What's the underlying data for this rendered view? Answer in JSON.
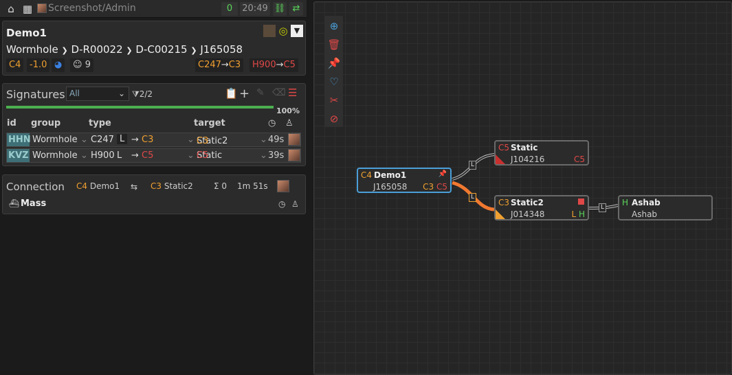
{
  "topbar": {
    "title": "Screenshot/Admin",
    "count": "0",
    "time": "20:49"
  },
  "system": {
    "name": "Demo1",
    "path": [
      "Wormhole",
      "D-R00022",
      "D-C00215",
      "J165058"
    ],
    "class": "C4",
    "security": "-1.0",
    "pilots": "9",
    "statics": [
      {
        "code": "C247",
        "target": "C3"
      },
      {
        "code": "H900",
        "target": "C5"
      }
    ]
  },
  "signatures": {
    "title": "Signatures",
    "filter": "All",
    "count": "2/2",
    "progress_label": "100%",
    "progress_value": 1.0,
    "columns": {
      "id": "id",
      "group": "group",
      "type": "type",
      "target": "target"
    },
    "rows": [
      {
        "id": "HHN",
        "group": "Wormhole",
        "type": "C247",
        "life": "L",
        "dest": "C3",
        "target": "Static2",
        "target_class": "C3",
        "age": "49s"
      },
      {
        "id": "KVZ",
        "group": "Wormhole",
        "type": "H900",
        "life": "L",
        "dest": "C5",
        "target": "Static",
        "target_class": "C5",
        "age": "39s"
      }
    ]
  },
  "connection": {
    "title": "Connection",
    "from_class": "C4",
    "from": "Demo1",
    "to_class": "C3",
    "to": "Static2",
    "mass_sum": "Σ 0",
    "age": "1m 51s",
    "mass_label": "Mass"
  },
  "map": {
    "nodes": [
      {
        "class": "C4",
        "name": "Demo1",
        "jid": "J165058",
        "eff1": "C3",
        "eff2": "C5"
      },
      {
        "class": "C5",
        "name": "Static",
        "jid": "J104216",
        "eff1": "C5"
      },
      {
        "class": "C3",
        "name": "Static2",
        "jid": "J014348",
        "eff1": "L",
        "eff2": "H"
      },
      {
        "class": "H",
        "name": "Ashab",
        "jid": "Ashab"
      }
    ],
    "link_label": "L"
  },
  "colors": {
    "c4": "#f0a030",
    "c5": "#e04848",
    "hs": "#5bd55b",
    "accent": "#4a9fd8"
  }
}
